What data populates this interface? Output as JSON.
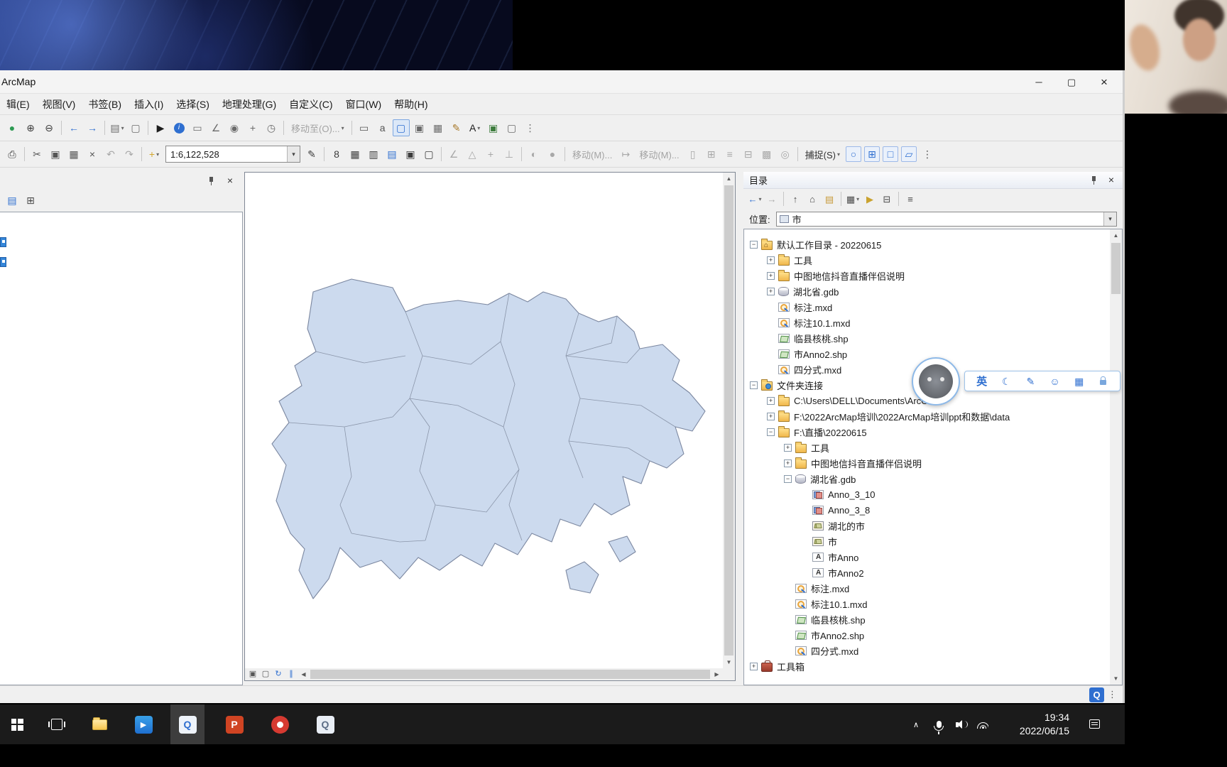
{
  "window": {
    "title": "ArcMap"
  },
  "icon_map": {
    "minimize-icon": "─",
    "maximize-icon": "▢",
    "close-icon": "×",
    "dropdown-icon": "▾"
  },
  "menu": {
    "items": [
      "辑(E)",
      "视图(V)",
      "书签(B)",
      "插入(I)",
      "选择(S)",
      "地理处理(G)",
      "自定义(C)",
      "窗口(W)",
      "帮助(H)"
    ]
  },
  "toolbars": {
    "scale": "1:6,122,528",
    "row1": [
      {
        "n": "pan-globe",
        "g": "●",
        "c": "#2c9a52"
      },
      {
        "n": "fixed-zoom-in",
        "g": "⊕",
        "c": "#3c3c3c"
      },
      {
        "n": "fixed-zoom-out",
        "g": "⊖",
        "c": "#3c3c3c"
      },
      {
        "t": "sep"
      },
      {
        "n": "previous-extent",
        "g": "←",
        "c": "#2f6fd0"
      },
      {
        "n": "next-extent",
        "g": "→",
        "c": "#2f6fd0"
      },
      {
        "t": "sep"
      },
      {
        "n": "add-layer",
        "g": "▤",
        "c": "#6b6b6b",
        "dd": 1
      },
      {
        "n": "viewer-window",
        "g": "▢",
        "c": "#6b6b6b"
      },
      {
        "t": "sep"
      },
      {
        "n": "select-elements",
        "g": "▶",
        "c": "#1c1c1c"
      },
      {
        "n": "identify",
        "g": "i",
        "chip": "#2f6fd0"
      },
      {
        "n": "html-popup",
        "g": "▭",
        "c": "#6b6b6b"
      },
      {
        "n": "measure",
        "g": "∠",
        "c": "#6b6b6b"
      },
      {
        "n": "find",
        "g": "◉",
        "c": "#6b6b6b"
      },
      {
        "n": "go-to-xy",
        "g": "+",
        "c": "#6b6b6b"
      },
      {
        "n": "time-slider",
        "g": "◷",
        "c": "#6b6b6b"
      },
      {
        "t": "sep"
      },
      {
        "t": "text",
        "n": "move-to-button",
        "label": "移动至(O)...",
        "gray": 1,
        "dd": 1
      },
      {
        "t": "sep"
      },
      {
        "n": "new-rectangle",
        "g": "▭",
        "c": "#555555"
      },
      {
        "n": "labels-lock",
        "g": "a",
        "c": "#555555"
      },
      {
        "n": "select-graphics",
        "g": "▢",
        "c": "#2f6fd0",
        "pressed": 1
      },
      {
        "n": "align-tool",
        "g": "▣",
        "c": "#6b6b6b"
      },
      {
        "n": "distribute-tool",
        "g": "▦",
        "c": "#6b6b6b"
      },
      {
        "n": "draw-pencil",
        "g": "✎",
        "c": "#a8792b"
      },
      {
        "n": "new-text",
        "g": "A",
        "c": "#1c1c1c",
        "dd": 1
      },
      {
        "n": "insert-picture",
        "g": "▣",
        "c": "#3e7d3e"
      },
      {
        "n": "new-dataframe",
        "g": "▢",
        "c": "#6b6b6b"
      },
      {
        "n": "toolbar-overflow",
        "g": "⋮",
        "c": "#6b6b6b"
      }
    ],
    "row2a": [
      {
        "n": "print",
        "g": "⎙",
        "c": "#3c3c3c"
      },
      {
        "t": "sep"
      },
      {
        "n": "cut",
        "g": "✂",
        "c": "#555555"
      },
      {
        "n": "copy",
        "g": "▣",
        "c": "#555555"
      },
      {
        "n": "paste",
        "g": "▦",
        "c": "#555555"
      },
      {
        "n": "delete",
        "g": "×",
        "c": "#555555"
      },
      {
        "n": "undo",
        "g": "↶",
        "gray": 1
      },
      {
        "n": "redo",
        "g": "↷",
        "gray": 1
      },
      {
        "t": "sep"
      },
      {
        "n": "add-data",
        "g": "+",
        "c": "#d2a72e",
        "dd": 1
      }
    ],
    "row2b": [
      {
        "n": "editor-pencil",
        "g": "✎",
        "c": "#3c3c3c"
      },
      {
        "t": "sep"
      },
      {
        "n": "editor-snap",
        "g": "8",
        "c": "#3c3c3c"
      },
      {
        "n": "attribute-table",
        "g": "▦",
        "c": "#3c3c3c"
      },
      {
        "n": "sketch-tool",
        "g": "▥",
        "c": "#3c3c3c"
      },
      {
        "n": "create-features",
        "g": "▤",
        "c": "#2f6fd0"
      },
      {
        "n": "editor-save",
        "g": "▣",
        "c": "#3c3c3c"
      },
      {
        "n": "editor-window",
        "g": "▢",
        "c": "#3c3c3c"
      },
      {
        "t": "sep"
      },
      {
        "n": "modify-1",
        "g": "∠",
        "gray": 1
      },
      {
        "n": "modify-2",
        "g": "△",
        "gray": 1
      },
      {
        "n": "modify-3",
        "g": "+",
        "gray": 1
      },
      {
        "n": "modify-4",
        "g": "⊥",
        "gray": 1
      },
      {
        "t": "sep"
      },
      {
        "n": "rotate-tool",
        "g": "◐",
        "gray": 1
      },
      {
        "n": "buffer-tool",
        "g": "●",
        "gray": 1
      },
      {
        "t": "sep"
      },
      {
        "t": "text",
        "n": "move-increment-button",
        "label": "移动(M)...",
        "gray": 1
      },
      {
        "n": "offset-tool",
        "g": "↦",
        "gray": 1
      },
      {
        "t": "text",
        "n": "move-annotation-button",
        "label": "移动(M)...",
        "gray": 1
      },
      {
        "n": "anno-tool-1",
        "g": "▯",
        "gray": 1
      },
      {
        "n": "anno-tool-2",
        "g": "⊞",
        "gray": 1
      },
      {
        "n": "anno-tool-3",
        "g": "≡",
        "gray": 1
      },
      {
        "n": "anno-tool-4",
        "g": "⊟",
        "gray": 1
      },
      {
        "n": "anno-tool-5",
        "g": "▩",
        "gray": 1
      },
      {
        "n": "anno-tool-6",
        "g": "◎",
        "gray": 1
      },
      {
        "t": "sep"
      },
      {
        "t": "text",
        "n": "snapping-menu",
        "label": "捕捉(S)",
        "dd": 1
      },
      {
        "n": "snap-point",
        "g": "○",
        "blue": 1
      },
      {
        "n": "snap-endpoint",
        "g": "⊞",
        "blue": 1
      },
      {
        "n": "snap-vertex",
        "g": "□",
        "blue": 1
      },
      {
        "n": "snap-edge",
        "g": "▱",
        "blue": 1
      },
      {
        "n": "row2-overflow",
        "g": "⋮",
        "c": "#555555"
      }
    ]
  },
  "toc": {
    "icons": [
      {
        "n": "toc-by-drawing-order",
        "g": "▤",
        "c": "#2f6fd0"
      },
      {
        "n": "toc-by-source",
        "g": "⊞",
        "c": "#4a4a4a"
      }
    ]
  },
  "map_nav": {
    "icons": [
      {
        "n": "data-view-button",
        "g": "▣",
        "c": "#555555"
      },
      {
        "n": "layout-view-button",
        "g": "▢",
        "c": "#555555"
      },
      {
        "n": "refresh-view-button",
        "g": "↻",
        "c": "#2f6fd0"
      },
      {
        "n": "pause-drawing-button",
        "g": "∥",
        "c": "#2f6fd0"
      }
    ]
  },
  "catalog": {
    "title": "目录",
    "location_label": "位置:",
    "location_value": "市",
    "toolbar": [
      {
        "n": "cat-back",
        "g": "←",
        "c": "#2f6fd0",
        "dd": 1
      },
      {
        "n": "cat-forward",
        "g": "→",
        "gray": 1
      },
      {
        "t": "sep"
      },
      {
        "n": "cat-up-one-level",
        "g": "↑",
        "c": "#4a4a4a"
      },
      {
        "n": "cat-home",
        "g": "⌂",
        "c": "#4a4a4a"
      },
      {
        "n": "cat-connect-folder",
        "g": "▤",
        "c": "#c89b3c"
      },
      {
        "t": "sep"
      },
      {
        "n": "cat-contents-view",
        "g": "▦",
        "c": "#4a4a4a",
        "dd": 1
      },
      {
        "n": "cat-launch",
        "g": "▶",
        "c": "#caa22e"
      },
      {
        "n": "cat-toggle-tree",
        "g": "⊟",
        "c": "#4a4a4a"
      },
      {
        "t": "sep"
      },
      {
        "n": "cat-options",
        "g": "≡",
        "c": "#4a4a4a"
      }
    ],
    "tree": [
      {
        "label": "默认工作目录 - 20220615",
        "depth": 0,
        "expand": "minus",
        "icon": "folder-home"
      },
      {
        "label": "工具",
        "depth": 1,
        "expand": "plus",
        "icon": "folder"
      },
      {
        "label": "中图地信抖音直播伴侣说明",
        "depth": 1,
        "expand": "plus",
        "icon": "folder"
      },
      {
        "label": "湖北省.gdb",
        "depth": 1,
        "expand": "plus",
        "icon": "gdb"
      },
      {
        "label": "标注.mxd",
        "depth": 1,
        "expand": "none",
        "icon": "mxd"
      },
      {
        "label": "标注10.1.mxd",
        "depth": 1,
        "expand": "none",
        "icon": "mxd"
      },
      {
        "label": "临县核桃.shp",
        "depth": 1,
        "expand": "none",
        "icon": "shp"
      },
      {
        "label": "市Anno2.shp",
        "depth": 1,
        "expand": "none",
        "icon": "shp"
      },
      {
        "label": "四分式.mxd",
        "depth": 1,
        "expand": "none",
        "icon": "mxd"
      },
      {
        "label": "文件夹连接",
        "depth": 0,
        "expand": "minus",
        "icon": "folder-conn"
      },
      {
        "label": "C:\\Users\\DELL\\Documents\\ArcGIS\\",
        "depth": 1,
        "expand": "plus",
        "icon": "folder"
      },
      {
        "label": "F:\\2022ArcMap培训\\2022ArcMap培训ppt和数据\\data",
        "depth": 1,
        "expand": "plus",
        "icon": "folder"
      },
      {
        "label": "F:\\直播\\20220615",
        "depth": 1,
        "expand": "minus",
        "icon": "folder"
      },
      {
        "label": "工具",
        "depth": 2,
        "expand": "plus",
        "icon": "folder"
      },
      {
        "label": "中图地信抖音直播伴侣说明",
        "depth": 2,
        "expand": "plus",
        "icon": "folder"
      },
      {
        "label": "湖北省.gdb",
        "depth": 2,
        "expand": "minus",
        "icon": "gdb"
      },
      {
        "label": "Anno_3_10",
        "depth": 3,
        "expand": "none",
        "icon": "anno-fds"
      },
      {
        "label": "Anno_3_8",
        "depth": 3,
        "expand": "none",
        "icon": "anno-fds"
      },
      {
        "label": "湖北的市",
        "depth": 3,
        "expand": "none",
        "icon": "fc-poly"
      },
      {
        "label": "市",
        "depth": 3,
        "expand": "none",
        "icon": "fc-poly"
      },
      {
        "label": "市Anno",
        "depth": 3,
        "expand": "none",
        "icon": "fc-anno"
      },
      {
        "label": "市Anno2",
        "depth": 3,
        "expand": "none",
        "icon": "fc-anno"
      },
      {
        "label": "标注.mxd",
        "depth": 2,
        "expand": "none",
        "icon": "mxd"
      },
      {
        "label": "标注10.1.mxd",
        "depth": 2,
        "expand": "none",
        "icon": "mxd"
      },
      {
        "label": "临县核桃.shp",
        "depth": 2,
        "expand": "none",
        "icon": "shp"
      },
      {
        "label": "市Anno2.shp",
        "depth": 2,
        "expand": "none",
        "icon": "shp"
      },
      {
        "label": "四分式.mxd",
        "depth": 2,
        "expand": "none",
        "icon": "mxd"
      },
      {
        "label": "工具箱",
        "depth": 0,
        "expand": "plus",
        "icon": "toolbox"
      }
    ]
  },
  "ime": {
    "items": [
      {
        "t": "text",
        "n": "ime-lang-toggle",
        "label": "英"
      },
      {
        "n": "ime-night-mode",
        "g": "☾",
        "c": "#2f6fd0"
      },
      {
        "n": "ime-handwriting",
        "g": "✎",
        "c": "#2f6fd0"
      },
      {
        "n": "ime-emoji",
        "g": "☺",
        "c": "#2f6fd0"
      },
      {
        "n": "ime-keyboard",
        "g": "▦",
        "c": "#2f6fd0"
      },
      {
        "n": "ime-lock",
        "g": "",
        "cls": "ime-lock-glyph"
      }
    ]
  },
  "statusbar": {
    "q_label": "Q",
    "overflow": "⋮"
  },
  "taskbar": {
    "time": "19:34",
    "date": "2022/06/15",
    "apps": {
      "powerpoint": "P",
      "arcmap": "Q",
      "search": "Q"
    }
  },
  "colors": {
    "accent": "#2f6fd0",
    "map_fill": "#ccdaee",
    "map_stroke": "#7b87a0",
    "selection": "#3586d8"
  }
}
